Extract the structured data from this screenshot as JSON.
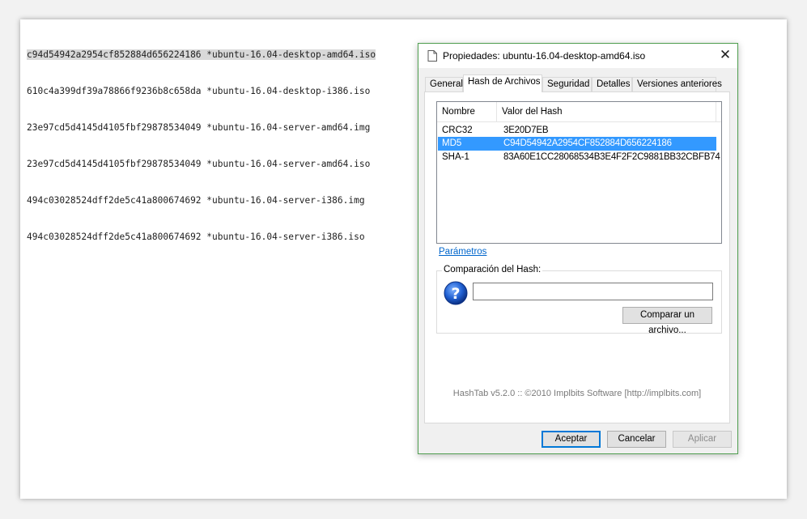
{
  "editor": {
    "lines": [
      "c94d54942a2954cf852884d656224186 *ubuntu-16.04-desktop-amd64.iso",
      "610c4a399df39a78866f9236b8c658da *ubuntu-16.04-desktop-i386.iso",
      "23e97cd5d4145d4105fbf29878534049 *ubuntu-16.04-server-amd64.img",
      "23e97cd5d4145d4105fbf29878534049 *ubuntu-16.04-server-amd64.iso",
      "494c03028524dff2de5c41a800674692 *ubuntu-16.04-server-i386.img",
      "494c03028524dff2de5c41a800674692 *ubuntu-16.04-server-i386.iso"
    ]
  },
  "dialog": {
    "title": "Propiedades: ubuntu-16.04-desktop-amd64.iso",
    "close_glyph": "✕",
    "tabs": [
      "General",
      "Hash de Archivos",
      "Seguridad",
      "Detalles",
      "Versiones anteriores"
    ],
    "active_tab": "Hash de Archivos",
    "list": {
      "headers": [
        "Nombre",
        "Valor del Hash"
      ],
      "rows": [
        {
          "name": "CRC32",
          "value": "3E20D7EB"
        },
        {
          "name": "MD5",
          "value": "C94D54942A2954CF852884D656224186"
        },
        {
          "name": "SHA-1",
          "value": "83A60E1CC28068534B3E4F2F2C9881BB32CBFB74"
        }
      ],
      "selected_row": "MD5"
    },
    "params_link": "Parámetros",
    "compare_group_label": "Comparación del Hash:",
    "compare_input_value": "",
    "compare_button": "Comparar un archivo...",
    "footer": "HashTab v5.2.0 :: ©2010 Implbits Software [http://implbits.com]",
    "buttons": {
      "ok": "Aceptar",
      "cancel": "Cancelar",
      "apply": "Aplicar"
    }
  },
  "colors": {
    "selection": "#3399ff",
    "link": "#0066cc",
    "dialog_border": "#4f9e4f"
  }
}
